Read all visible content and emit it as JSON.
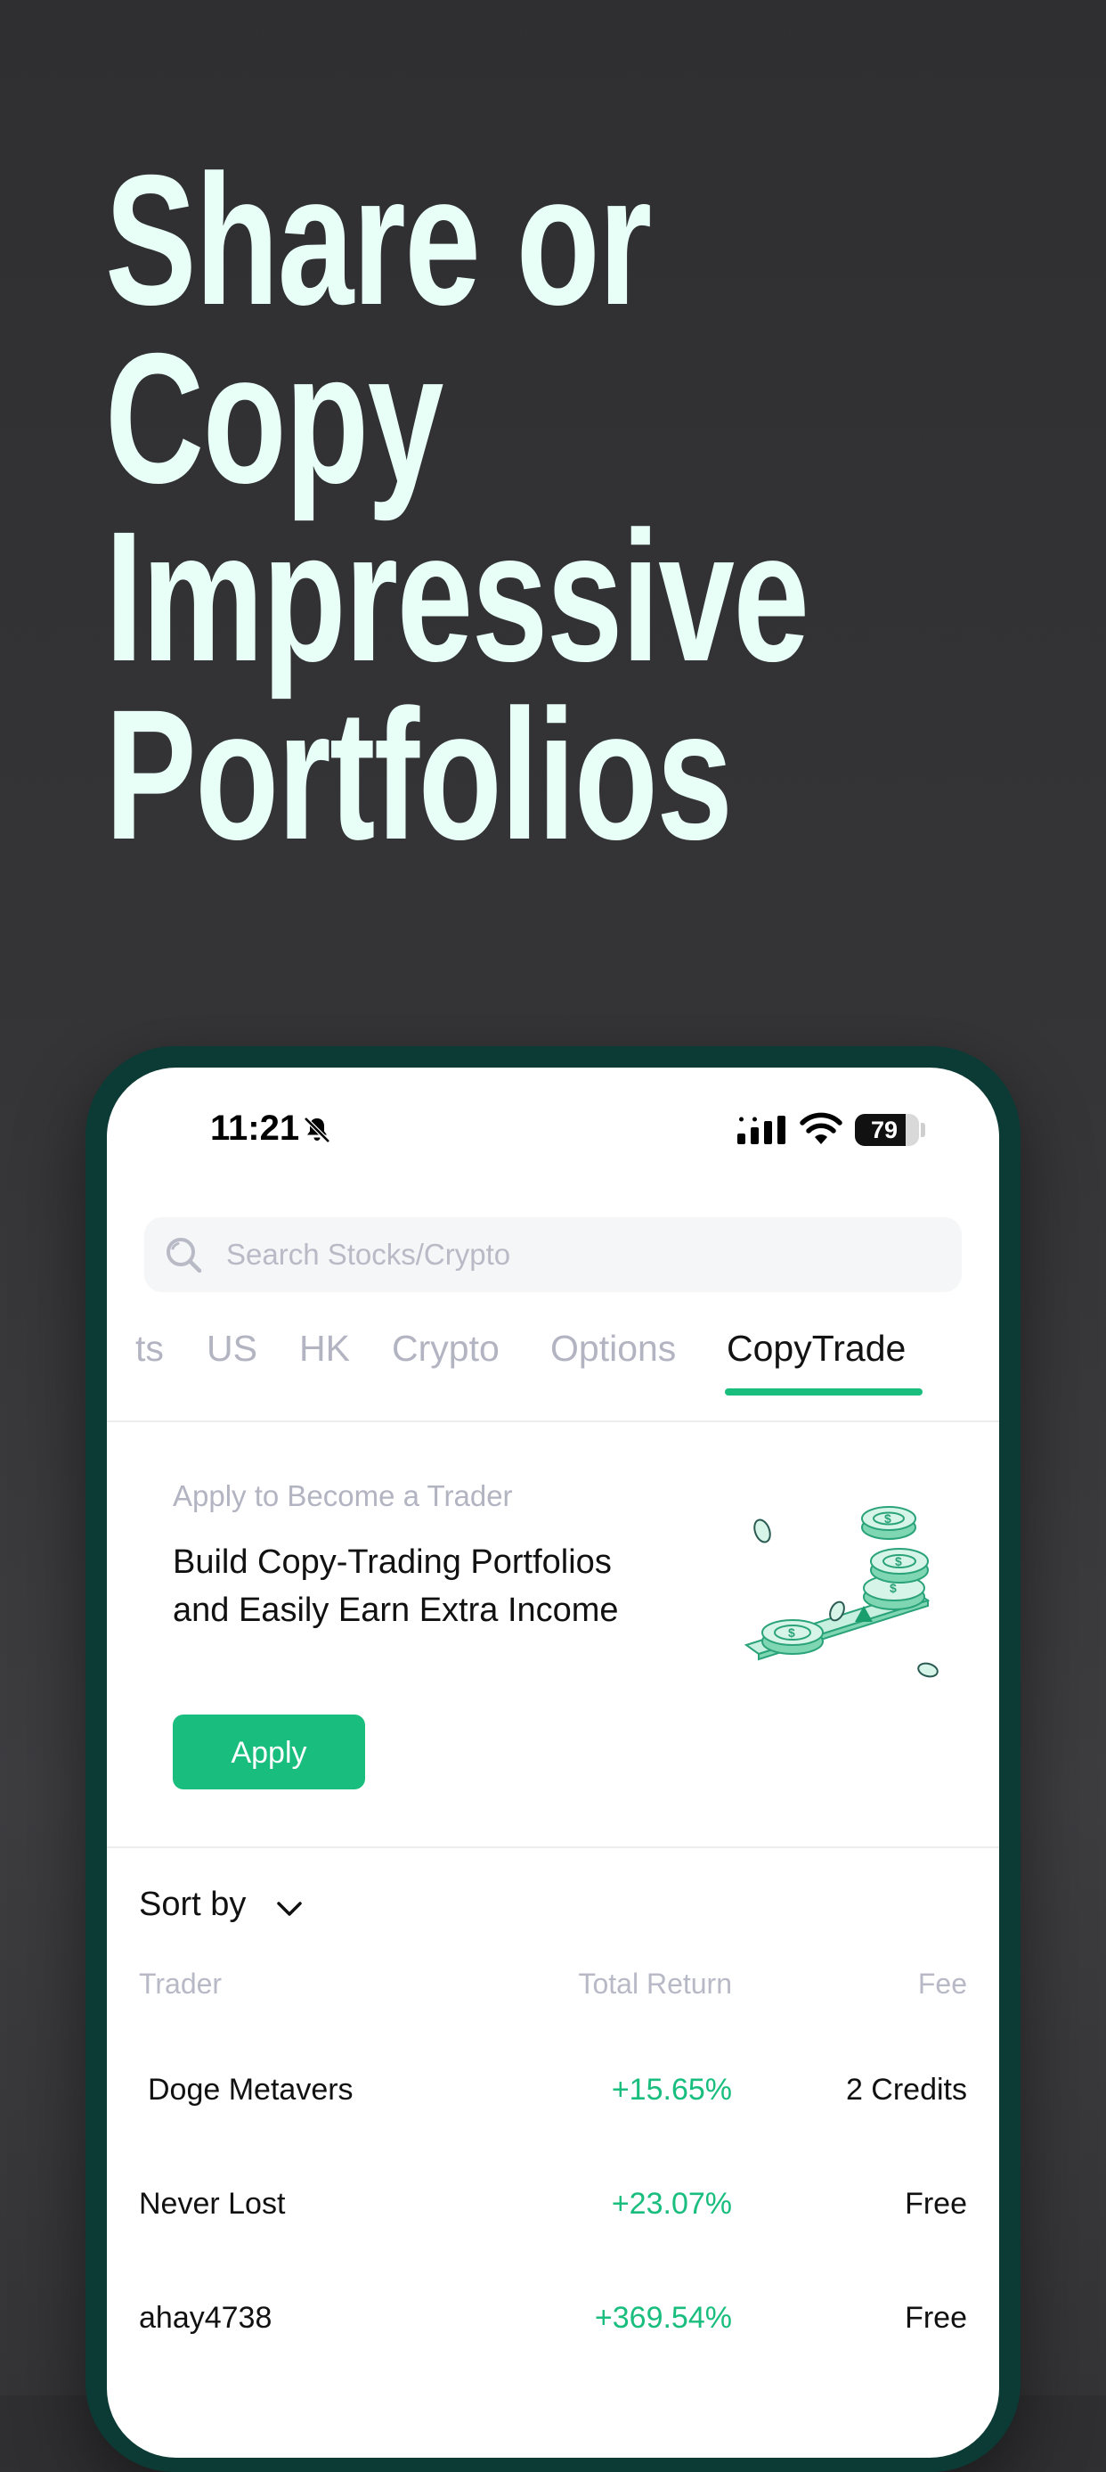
{
  "headline": {
    "line1": "Share or",
    "line2": "Copy",
    "line3": "Impressive",
    "line4": "Portfolios"
  },
  "status_bar": {
    "time": "11:21",
    "battery": "79",
    "battery_level": 0.79
  },
  "search": {
    "placeholder": "Search Stocks/Crypto"
  },
  "tabs": [
    {
      "label": "ts"
    },
    {
      "label": "US"
    },
    {
      "label": "HK"
    },
    {
      "label": "Crypto"
    },
    {
      "label": "Options"
    },
    {
      "label": "CopyTrade",
      "active": true
    }
  ],
  "banner": {
    "subtitle": "Apply to Become a Trader",
    "title": "Build Copy-Trading Portfolios and Easily Earn Extra Income",
    "button": "Apply"
  },
  "list": {
    "sort_label": "Sort by",
    "columns": {
      "trader": "Trader",
      "total_return": "Total Return",
      "fee": "Fee"
    },
    "rows": [
      {
        "trader": "Doge Metavers",
        "total_return": "+15.65%",
        "fee": "2 Credits"
      },
      {
        "trader": "Never Lost",
        "total_return": "+23.07%",
        "fee": "Free"
      },
      {
        "trader": "ahay4738",
        "total_return": "+369.54%",
        "fee": "Free"
      }
    ]
  },
  "colors": {
    "accent": "#19bd7d",
    "headline": "#e8fff8",
    "phone_frame": "#0c3a35",
    "background": "#333335"
  }
}
